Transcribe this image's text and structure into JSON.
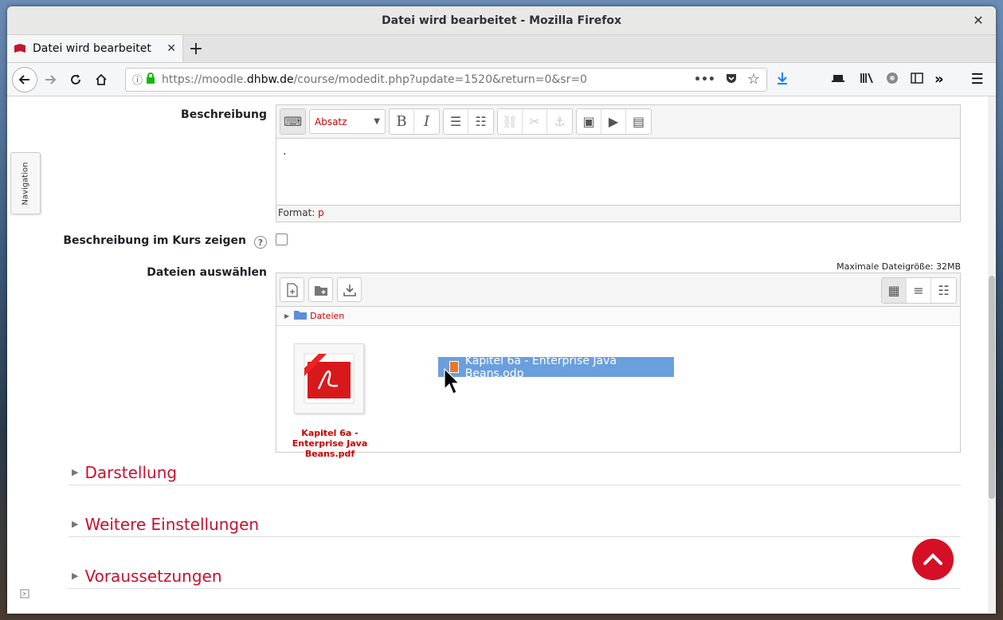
{
  "window": {
    "title": "Datei wird bearbeitet - Mozilla Firefox"
  },
  "tab": {
    "title": "Datei wird bearbeitet"
  },
  "url": {
    "prefix": "https://moodle.",
    "host": "dhbw.de",
    "path": "/course/modedit.php?update=1520&return=0&sr=0"
  },
  "sidebar": {
    "nav_label": "Navigation"
  },
  "form": {
    "beschreibung_label": "Beschreibung",
    "format_select": "Absatz",
    "editor_content": ".",
    "status_prefix": "Format:",
    "status_value": "p",
    "show_desc_label": "Beschreibung im Kurs zeigen",
    "files_label": "Dateien auswählen",
    "max_size": "Maximale Dateigröße: 32MB",
    "folder_name": "Dateien",
    "file_name": "Kapitel 6a - Enterprise Java Beans.pdf",
    "drag_file": "Kapitel 6a - Enterprise Java Beans.odp"
  },
  "sections": [
    "Darstellung",
    "Weitere Einstellungen",
    "Voraussetzungen"
  ],
  "colors": {
    "accent": "#c8102e",
    "back_to_top": "#d50f25",
    "drag_bg": "#6a9fde"
  }
}
